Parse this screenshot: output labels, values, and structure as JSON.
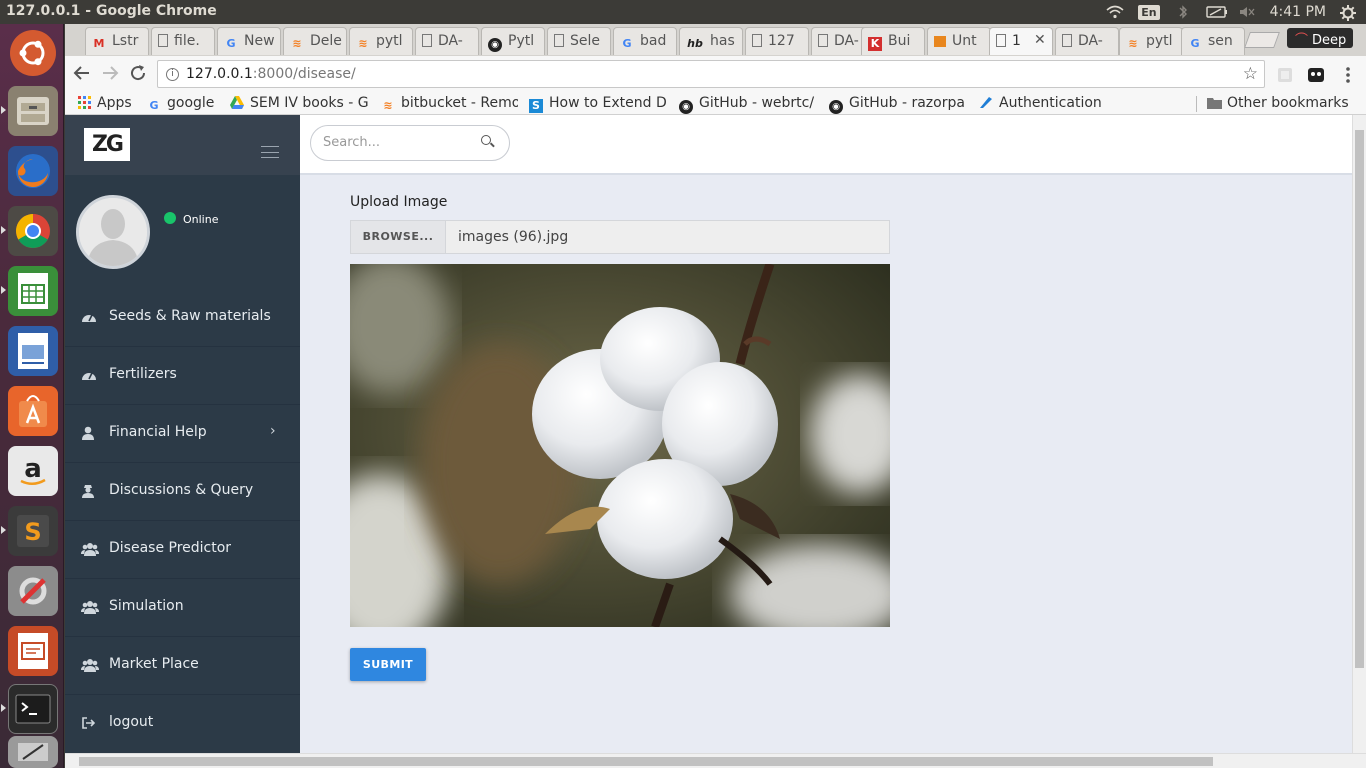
{
  "os": {
    "window_title": "127.0.0.1 - Google Chrome",
    "keyboard_layout": "En",
    "clock": "4:41 PM"
  },
  "browser": {
    "tabs": [
      {
        "label": "Lstr",
        "icon": "gmail-icon"
      },
      {
        "label": "file.",
        "icon": "page-icon"
      },
      {
        "label": "New",
        "icon": "google-icon"
      },
      {
        "label": "Dele",
        "icon": "stackoverflow-icon"
      },
      {
        "label": "pytl",
        "icon": "stackoverflow-icon"
      },
      {
        "label": "DA-",
        "icon": "page-icon"
      },
      {
        "label": "Pytl",
        "icon": "github-icon"
      },
      {
        "label": "Sele",
        "icon": "page-icon"
      },
      {
        "label": "bad",
        "icon": "google-icon"
      },
      {
        "label": "has",
        "icon": "hb-icon"
      },
      {
        "label": "127",
        "icon": "page-icon"
      },
      {
        "label": "DA-",
        "icon": "page-icon"
      },
      {
        "label": "Bui",
        "icon": "k-icon"
      },
      {
        "label": "Unt",
        "icon": "book-icon"
      },
      {
        "label": "1",
        "icon": "page-icon"
      },
      {
        "label": "DA-",
        "icon": "page-icon"
      },
      {
        "label": "pytl",
        "icon": "stackoverflow-icon"
      },
      {
        "label": "sen",
        "icon": "google-icon"
      }
    ],
    "profile_name": "Deep",
    "url_host": "127.0.0.1",
    "url_path": ":8000/disease/",
    "bookmarks": [
      {
        "label": "Apps",
        "icon": "apps-grid-icon"
      },
      {
        "label": "google",
        "icon": "google-icon"
      },
      {
        "label": "SEM IV books - G",
        "icon": "drive-icon"
      },
      {
        "label": "bitbucket - Remo",
        "icon": "stackoverflow-icon"
      },
      {
        "label": "How to Extend D",
        "icon": "s-icon"
      },
      {
        "label": "GitHub - webrtc/",
        "icon": "github-icon"
      },
      {
        "label": "GitHub - razorpa",
        "icon": "github-icon"
      },
      {
        "label": "Authentication",
        "icon": "auth-icon"
      },
      {
        "label": "Other bookmarks",
        "icon": "folder-icon"
      }
    ]
  },
  "app": {
    "logo_text": "ZG",
    "user_status": "Online",
    "search_placeholder": "Search...",
    "nav": [
      {
        "label": "Seeds & Raw materials",
        "icon": "dashboard-icon"
      },
      {
        "label": "Fertilizers",
        "icon": "dashboard-icon"
      },
      {
        "label": "Financial Help",
        "icon": "user-icon",
        "has_submenu": true
      },
      {
        "label": "Discussions & Query",
        "icon": "user-secret-icon"
      },
      {
        "label": "Disease Predictor",
        "icon": "users-icon"
      },
      {
        "label": "Simulation",
        "icon": "users-icon"
      },
      {
        "label": "Market Place",
        "icon": "users-icon"
      },
      {
        "label": "logout",
        "icon": "sign-out-icon"
      }
    ],
    "upload": {
      "label": "Upload Image",
      "browse_label": "BROWSE...",
      "file_name": "images (96).jpg",
      "submit_label": "SUBMIT"
    }
  }
}
